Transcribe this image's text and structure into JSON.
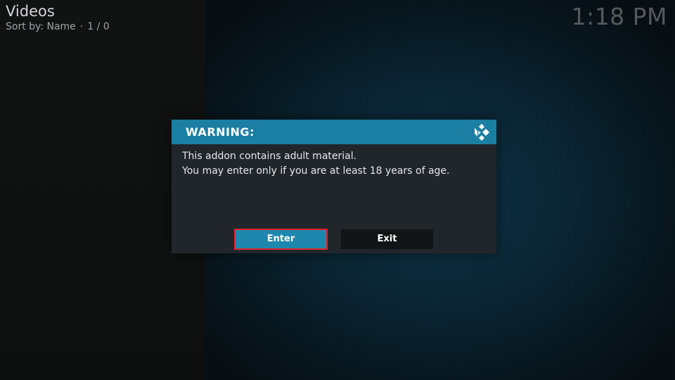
{
  "header": {
    "title": "Videos",
    "sort_label": "Sort by: Name",
    "separator": "·",
    "count": "1 / 0"
  },
  "clock": "1:18 PM",
  "dialog": {
    "title": "WARNING:",
    "lines": [
      "This addon contains adult material.",
      "You may enter only if you are at least 18 years of age."
    ],
    "buttons": {
      "enter": "Enter",
      "exit": "Exit"
    },
    "logo_icon": "kodi-logo-icon"
  },
  "colors": {
    "accent": "#1a7fa3",
    "dialog_bg": "#20262a",
    "focus_border": "#e0242c"
  }
}
